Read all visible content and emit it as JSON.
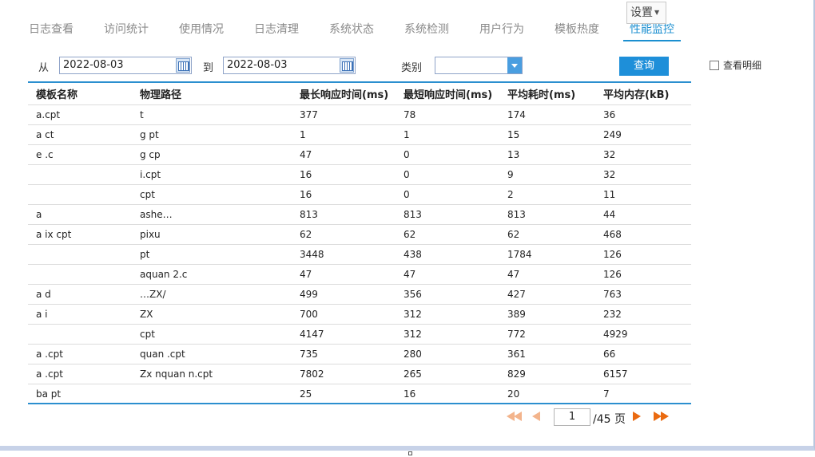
{
  "header": {
    "tabs": [
      {
        "label": "日志查看",
        "active": false
      },
      {
        "label": "访问统计",
        "active": false
      },
      {
        "label": "使用情况",
        "active": false
      },
      {
        "label": "日志清理",
        "active": false
      },
      {
        "label": "系统状态",
        "active": false
      },
      {
        "label": "系统检测",
        "active": false
      },
      {
        "label": "用户行为",
        "active": false
      },
      {
        "label": "模板热度",
        "active": false
      },
      {
        "label": "性能监控",
        "active": true
      }
    ],
    "settings_label": "设置",
    "accent_color": "#1b8fd0"
  },
  "filter": {
    "from_label": "从",
    "from_date": "2022-08-03",
    "to_label": "到",
    "to_date": "2022-08-03",
    "category_label": "类别",
    "category_value": "",
    "query_label": "查询",
    "detail_label": "查看明细",
    "detail_checked": false
  },
  "table": {
    "columns": [
      "模板名称",
      "物理路径",
      "最长响应时间(ms)",
      "最短响应时间(ms)",
      "平均耗时(ms)",
      "平均内存(kB)"
    ],
    "rows": [
      [
        "a.cpt",
        "t",
        "377",
        "78",
        "174",
        "36"
      ],
      [
        "a ct",
        "g pt",
        "1",
        "1",
        "15",
        "249"
      ],
      [
        "e .c",
        "g cp",
        "47",
        "0",
        "13",
        "32"
      ],
      [
        "",
        "i.cpt",
        "16",
        "0",
        "9",
        "32"
      ],
      [
        "",
        "cpt",
        "16",
        "0",
        "2",
        "11"
      ],
      [
        "a",
        "ashe…",
        "813",
        "813",
        "813",
        "44"
      ],
      [
        "a ix cpt",
        "pixu",
        "62",
        "62",
        "62",
        "468"
      ],
      [
        "",
        "pt",
        "3448",
        "438",
        "1784",
        "126"
      ],
      [
        "",
        "aquan 2.c",
        "47",
        "47",
        "47",
        "126"
      ],
      [
        "a d",
        "…ZX/",
        "499",
        "356",
        "427",
        "763"
      ],
      [
        "a i",
        "ZX",
        "700",
        "312",
        "389",
        "232"
      ],
      [
        "",
        "cpt",
        "4147",
        "312",
        "772",
        "4929"
      ],
      [
        "a .cpt",
        "quan .cpt",
        "735",
        "280",
        "361",
        "66"
      ],
      [
        "a .cpt",
        "Zx nquan n.cpt",
        "7802",
        "265",
        "829",
        "6157"
      ],
      [
        "ba pt",
        "",
        "25",
        "16",
        "20",
        "7"
      ]
    ]
  },
  "pager": {
    "current_page": "1",
    "total_text": "/45 页"
  }
}
